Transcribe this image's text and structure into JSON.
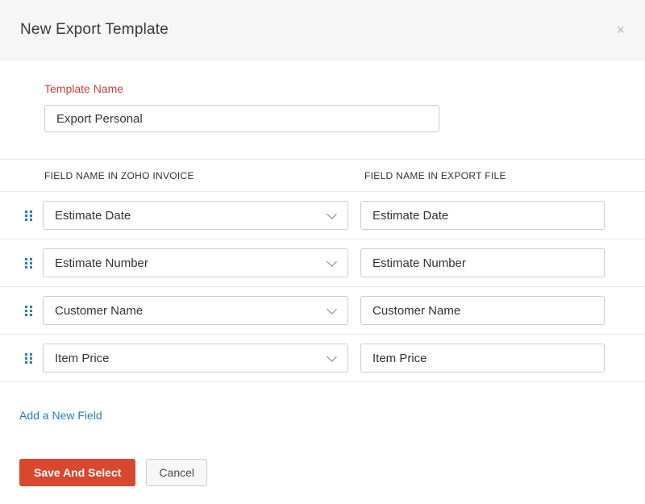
{
  "dialog": {
    "title": "New Export Template",
    "close_icon": "×"
  },
  "form": {
    "template_name_label": "Template Name",
    "template_name_value": "Export Personal"
  },
  "table": {
    "columns": [
      "FIELD NAME IN ZOHO INVOICE",
      "FIELD NAME IN EXPORT FILE"
    ],
    "rows": [
      {
        "zoho_field": "Estimate Date",
        "export_field": "Estimate Date"
      },
      {
        "zoho_field": "Estimate Number",
        "export_field": "Estimate Number"
      },
      {
        "zoho_field": "Customer Name",
        "export_field": "Customer Name"
      },
      {
        "zoho_field": "Item Price",
        "export_field": "Item Price"
      }
    ]
  },
  "actions": {
    "add_field_label": "Add a New Field",
    "save_label": "Save And Select",
    "cancel_label": "Cancel"
  },
  "colors": {
    "label-red": "#c8403a",
    "primary-button": "#d9472e",
    "link-blue": "#2080c4",
    "drag-dot-blue": "#2e78b8"
  }
}
